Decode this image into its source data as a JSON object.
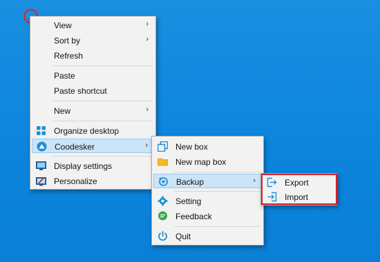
{
  "main_menu": {
    "view": "View",
    "sort_by": "Sort by",
    "refresh": "Refresh",
    "paste": "Paste",
    "paste_shortcut": "Paste shortcut",
    "new": "New",
    "organize_desktop": "Organize desktop",
    "coodesker": "Coodesker",
    "display_settings": "Display settings",
    "personalize": "Personalize"
  },
  "coodesker_menu": {
    "new_box": "New box",
    "new_map_box": "New map box",
    "backup": "Backup",
    "setting": "Setting",
    "feedback": "Feedback",
    "quit": "Quit"
  },
  "backup_menu": {
    "export": "Export",
    "import": "Import"
  },
  "colors": {
    "desktop": "#0d86de",
    "highlight": "#cce4f7",
    "accent_icon": "#1e90d6",
    "annotation": "#d6202a"
  },
  "icons": {
    "submenu_arrow": "chevron-right-icon",
    "organize_desktop": "grid-icon",
    "coodesker": "coodesker-logo-icon",
    "display_settings": "monitor-icon",
    "personalize": "paint-monitor-icon",
    "new_box": "copy-box-icon",
    "new_map_box": "folder-icon",
    "backup": "backup-icon",
    "setting": "gear-icon",
    "feedback": "chat-icon",
    "quit": "power-icon",
    "export": "export-icon",
    "import": "import-icon"
  }
}
